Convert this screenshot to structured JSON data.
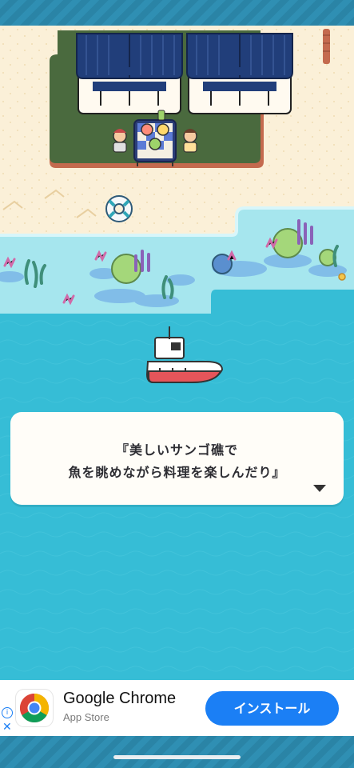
{
  "dialog": {
    "line1": "『美しいサンゴ礁で",
    "line2": "魚を眺めながら料理を楽しんだり』"
  },
  "ad": {
    "app_name": "Google Chrome",
    "store": "App Store",
    "install_label": "インストール",
    "info_glyph": "i",
    "close_glyph": "✕"
  },
  "colors": {
    "sea_deep": "#36bdd6",
    "sea_shallow": "#a6e6ee",
    "sand": "#fbf0d8",
    "grass": "#4a6a3e",
    "roof": "#213e7a",
    "install_button": "#1b7ff5"
  }
}
